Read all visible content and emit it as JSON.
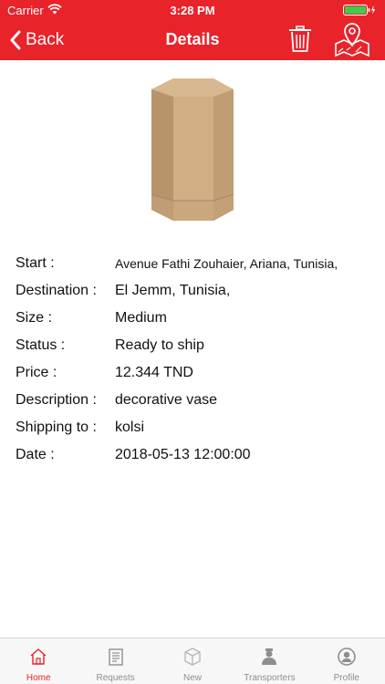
{
  "status_bar": {
    "carrier": "Carrier",
    "time": "3:28 PM"
  },
  "nav": {
    "back_label": "Back",
    "title": "Details"
  },
  "details": [
    {
      "label": "Start :",
      "value": "Avenue Fathi Zouhaier, Ariana, Tunisia,"
    },
    {
      "label": "Destination :",
      "value": "El Jemm, Tunisia,"
    },
    {
      "label": "Size :",
      "value": "Medium"
    },
    {
      "label": "Status :",
      "value": "Ready to ship"
    },
    {
      "label": "Price :",
      "value": "12.344 TND"
    },
    {
      "label": "Description :",
      "value": "decorative vase"
    },
    {
      "label": "Shipping to :",
      "value": "kolsi"
    },
    {
      "label": "Date :",
      "value": "2018-05-13 12:00:00"
    }
  ],
  "tabs": [
    {
      "label": "Home",
      "icon": "home-icon",
      "active": true
    },
    {
      "label": "Requests",
      "icon": "document-icon",
      "active": false
    },
    {
      "label": "New",
      "icon": "box-icon",
      "active": false
    },
    {
      "label": "Transporters",
      "icon": "transporter-icon",
      "active": false
    },
    {
      "label": "Profile",
      "icon": "profile-icon",
      "active": false
    }
  ],
  "colors": {
    "accent": "#e8232a",
    "tab_inactive": "#8e8e8e",
    "cardboard": "#c9a57d"
  }
}
